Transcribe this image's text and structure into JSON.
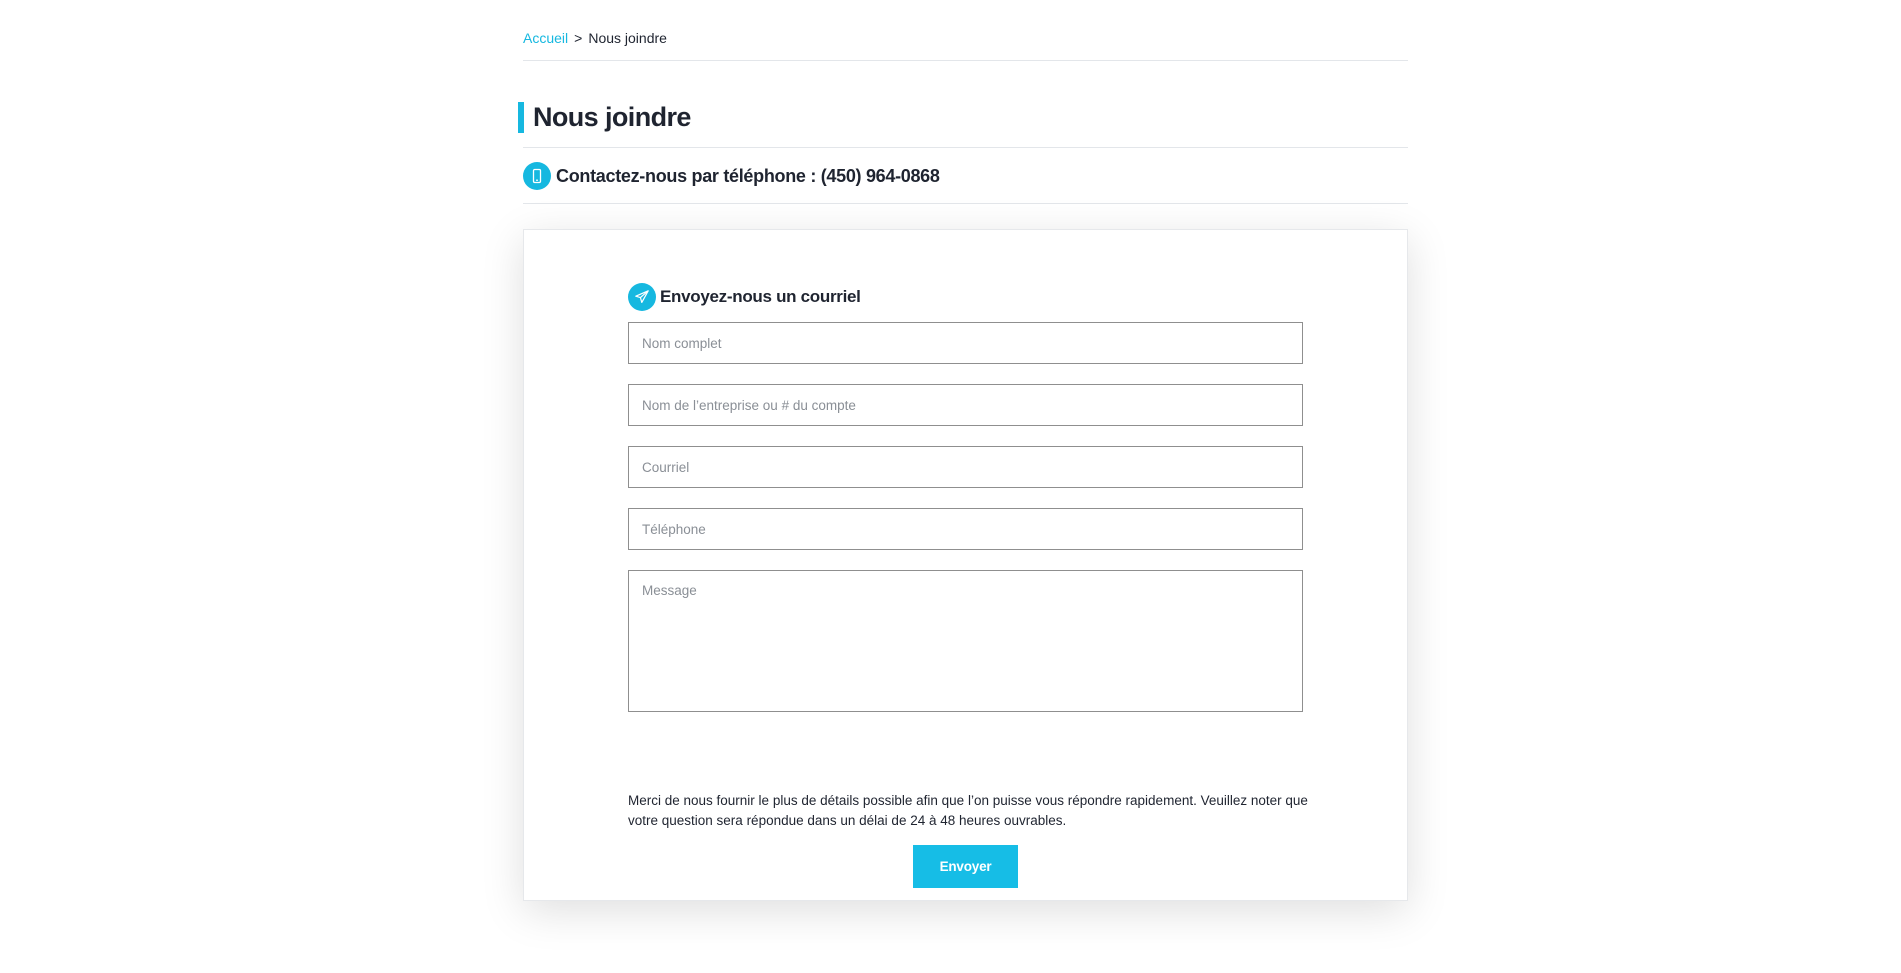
{
  "breadcrumb": {
    "home": "Accueil",
    "separator": ">",
    "current": "Nous joindre"
  },
  "page": {
    "title": "Nous joindre"
  },
  "phone": {
    "label": "Contactez-nous par téléphone : (450) 964-0868",
    "icon": "mobile-phone-icon"
  },
  "form": {
    "heading": "Envoyez-nous un courriel",
    "heading_icon": "paper-plane-icon",
    "fields": {
      "full_name": {
        "placeholder": "Nom complet",
        "value": ""
      },
      "company": {
        "placeholder": "Nom de l’entreprise ou # du compte",
        "value": ""
      },
      "email": {
        "placeholder": "Courriel",
        "value": ""
      },
      "phone": {
        "placeholder": "Téléphone",
        "value": ""
      },
      "message": {
        "placeholder": "Message",
        "value": ""
      }
    },
    "note": "Merci de nous fournir le plus de détails possible afin que l’on puisse vous répondre rapidement. Veuillez noter que votre question sera répondue dans un délai de 24 à 48 heures ouvrables.",
    "submit_label": "Envoyer"
  },
  "colors": {
    "accent": "#16b8e0",
    "text": "#1f2430",
    "button": "#16bde6"
  }
}
